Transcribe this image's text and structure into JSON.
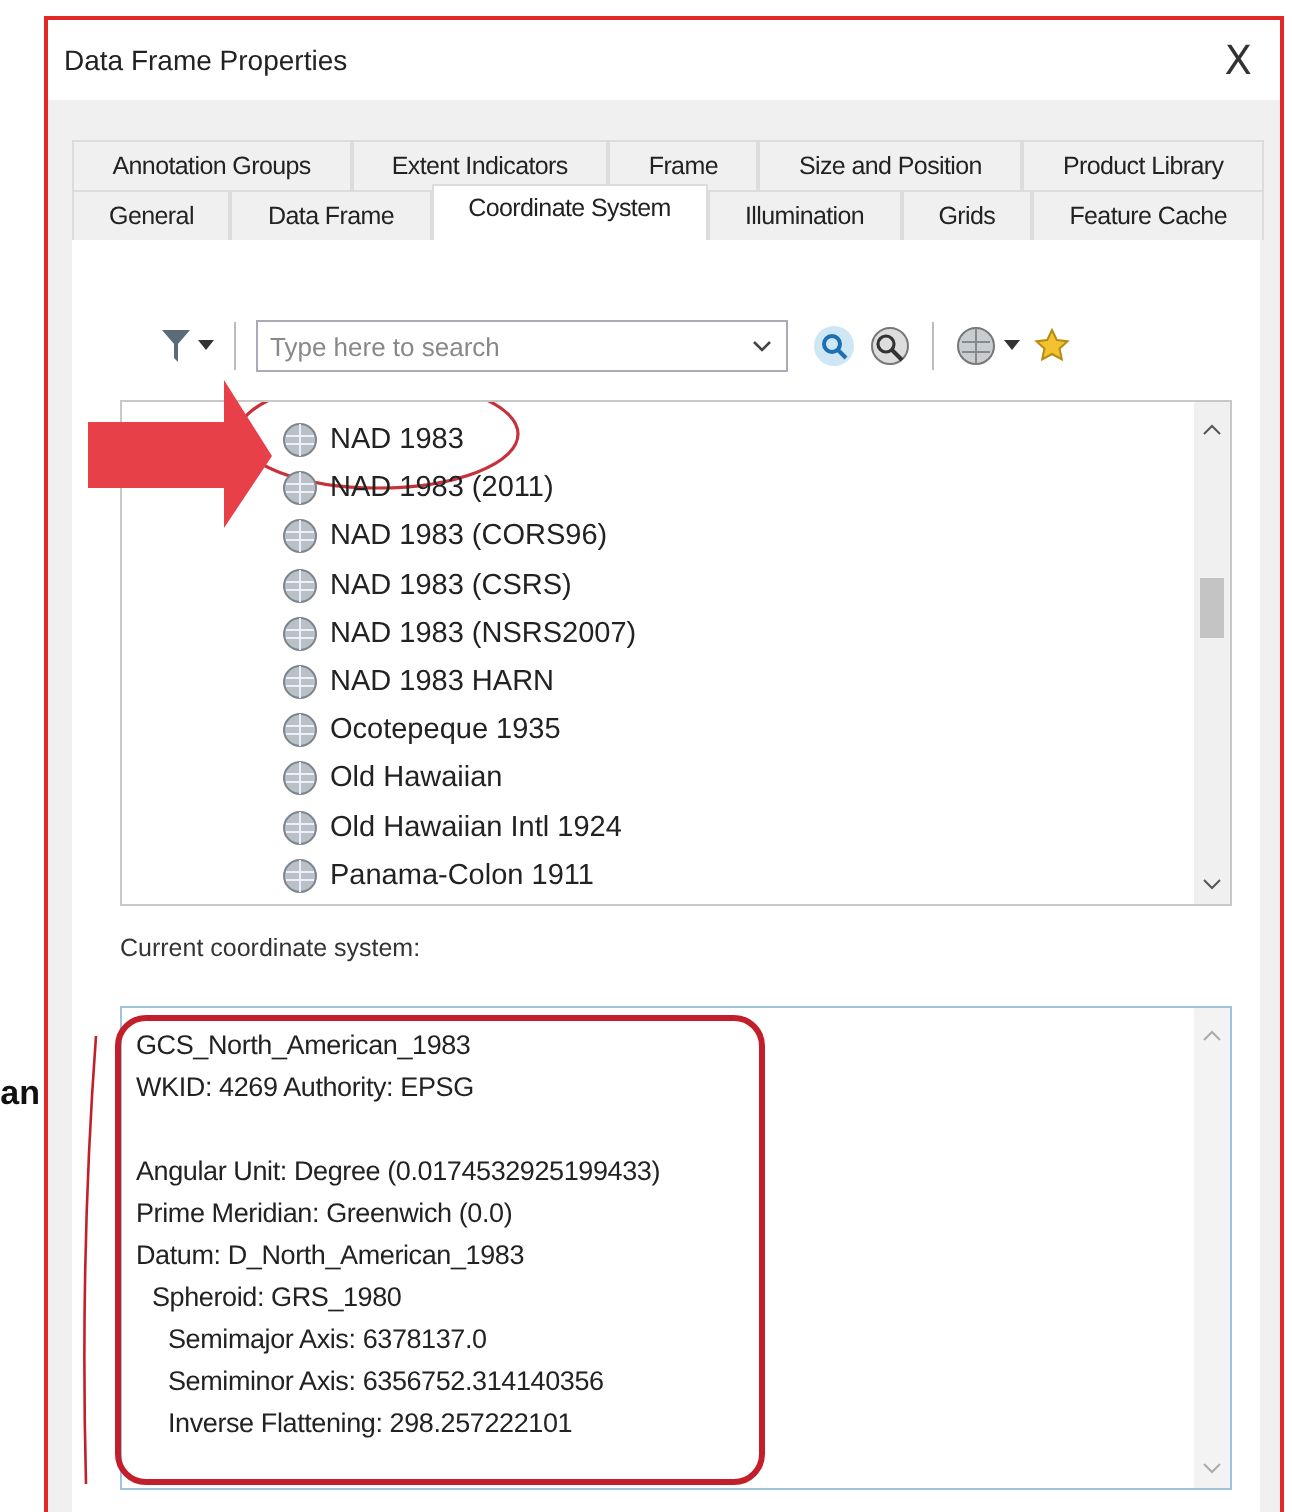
{
  "outside_text": "an",
  "window": {
    "title": "Data Frame Properties",
    "close": "X"
  },
  "tab_rows": [
    {
      "tabs": [
        {
          "label": "Annotation Groups",
          "selected": false
        },
        {
          "label": "Extent Indicators",
          "selected": false
        },
        {
          "label": "Frame",
          "selected": false
        },
        {
          "label": "Size and Position",
          "selected": false
        },
        {
          "label": "Product Library",
          "selected": false
        }
      ]
    },
    {
      "tabs": [
        {
          "label": "General",
          "selected": false
        },
        {
          "label": "Data Frame",
          "selected": false
        },
        {
          "label": "Coordinate System",
          "selected": true
        },
        {
          "label": "Illumination",
          "selected": false
        },
        {
          "label": "Grids",
          "selected": false
        },
        {
          "label": "Feature Cache",
          "selected": false
        }
      ]
    }
  ],
  "search": {
    "placeholder": "Type here to search"
  },
  "coordinate_list": [
    {
      "label": "NAD 1983",
      "highlighted": true
    },
    {
      "label": "NAD 1983 (2011)",
      "highlighted": false
    },
    {
      "label": "NAD 1983 (CORS96)",
      "highlighted": false
    },
    {
      "label": "NAD 1983 (CSRS)",
      "highlighted": false
    },
    {
      "label": "NAD 1983 (NSRS2007)",
      "highlighted": false
    },
    {
      "label": "NAD 1983 HARN",
      "highlighted": false
    },
    {
      "label": "Ocotepeque 1935",
      "highlighted": false
    },
    {
      "label": "Old Hawaiian",
      "highlighted": false
    },
    {
      "label": "Old Hawaiian Intl 1924",
      "highlighted": false
    },
    {
      "label": "Panama-Colon 1911",
      "highlighted": false
    }
  ],
  "current_label": "Current coordinate system:",
  "current_details": [
    {
      "lines": [
        {
          "text": "GCS_North_American_1983"
        },
        {
          "text": "WKID: 4269 Authority: EPSG"
        }
      ]
    },
    {
      "lines": [
        {
          "text": "Angular Unit: Degree (0.0174532925199433)"
        },
        {
          "text": "Prime Meridian: Greenwich (0.0)"
        },
        {
          "text": "Datum: D_North_American_1983",
          "children": [
            {
              "text": "Spheroid: GRS_1980",
              "children": [
                {
                  "text": "Semimajor Axis: 6378137.0"
                },
                {
                  "text": "Semiminor Axis: 6356752.314140356"
                },
                {
                  "text": "Inverse Flattening: 298.257222101"
                }
              ]
            }
          ]
        }
      ]
    }
  ]
}
